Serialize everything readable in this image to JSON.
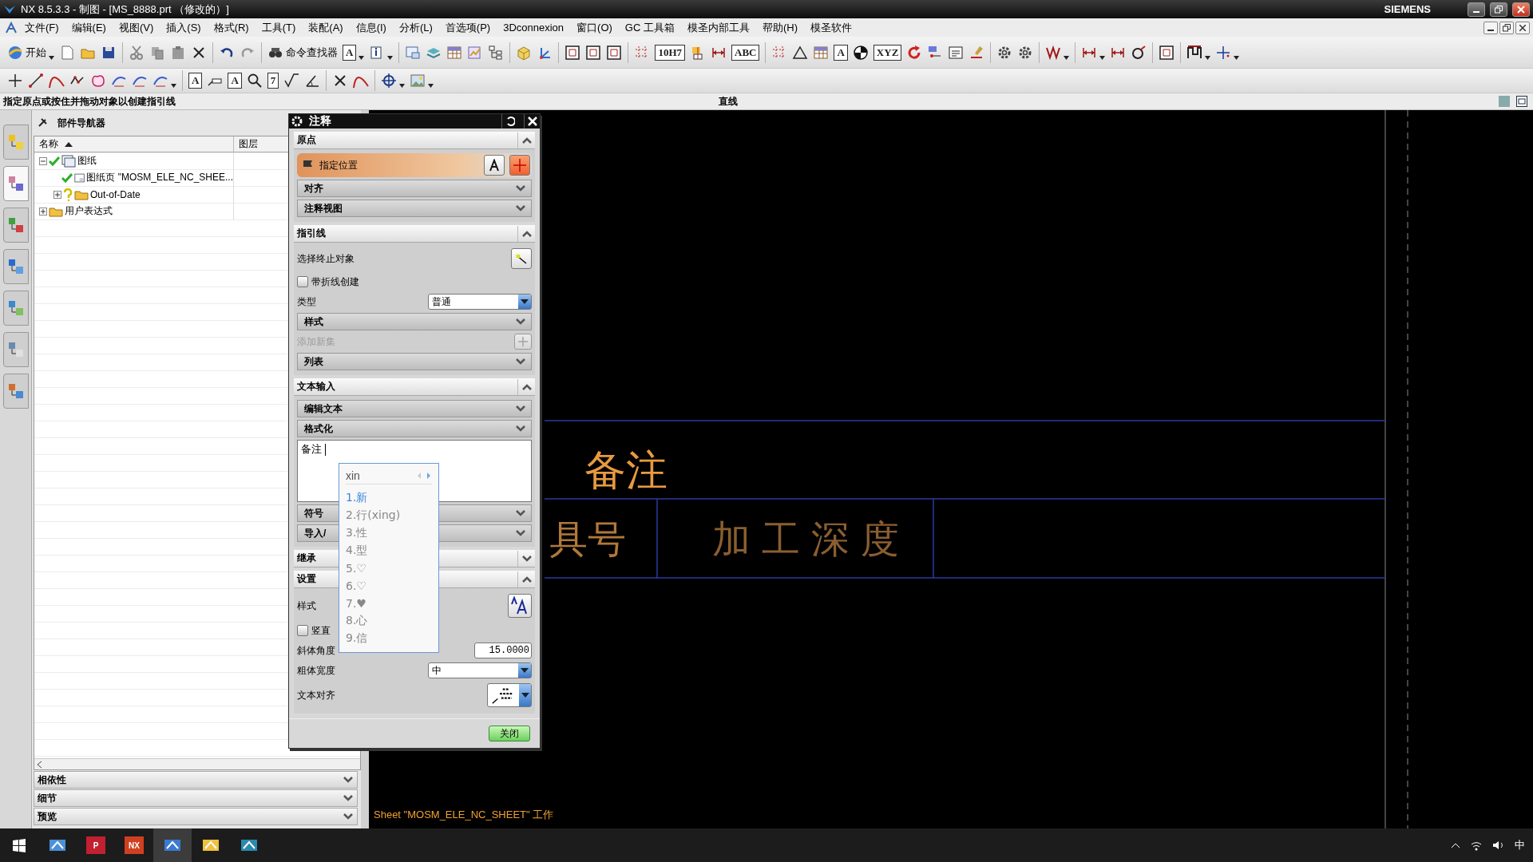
{
  "window": {
    "title": "NX 8.5.3.3 - 制图 - [MS_8888.prt  （修改的）]",
    "brand": "SIEMENS"
  },
  "menu": [
    "文件(F)",
    "编辑(E)",
    "视图(V)",
    "插入(S)",
    "格式(R)",
    "工具(T)",
    "装配(A)",
    "信息(I)",
    "分析(L)",
    "首选项(P)",
    "3Dconnexion",
    "窗口(O)",
    "GC 工具箱",
    "模圣内部工具",
    "帮助(H)",
    "模圣软件"
  ],
  "toolbar_1": [
    {
      "kind": "text",
      "text": "开始",
      "menu": true
    },
    {
      "kind": "icon"
    },
    {
      "kind": "icon"
    },
    {
      "kind": "icon"
    },
    {
      "kind": "sep"
    },
    {
      "kind": "icon"
    },
    {
      "kind": "icon"
    },
    {
      "kind": "icon"
    },
    {
      "kind": "icon"
    },
    {
      "kind": "sep"
    },
    {
      "kind": "icon"
    },
    {
      "kind": "icon"
    },
    {
      "kind": "sep"
    },
    {
      "kind": "text",
      "text": "命令查找器"
    },
    {
      "kind": "glyph",
      "text": "A",
      "menu": true
    },
    {
      "kind": "icon",
      "menu": true
    },
    {
      "kind": "sep"
    },
    {
      "kind": "icon"
    },
    {
      "kind": "icon"
    },
    {
      "kind": "icon"
    },
    {
      "kind": "icon"
    },
    {
      "kind": "icon"
    },
    {
      "kind": "sep"
    },
    {
      "kind": "icon"
    },
    {
      "kind": "icon"
    },
    {
      "kind": "sep"
    },
    {
      "kind": "icon"
    },
    {
      "kind": "icon"
    },
    {
      "kind": "icon"
    },
    {
      "kind": "sep"
    },
    {
      "kind": "icon"
    },
    {
      "kind": "glyph",
      "text": "10H7"
    },
    {
      "kind": "icon"
    },
    {
      "kind": "icon"
    },
    {
      "kind": "glyph",
      "text": "ABC"
    },
    {
      "kind": "sep"
    },
    {
      "kind": "icon"
    },
    {
      "kind": "icon"
    },
    {
      "kind": "icon"
    },
    {
      "kind": "glyph",
      "text": "A"
    },
    {
      "kind": "icon"
    },
    {
      "kind": "glyph",
      "text": "XYZ"
    },
    {
      "kind": "icon"
    },
    {
      "kind": "icon"
    },
    {
      "kind": "icon"
    },
    {
      "kind": "icon"
    },
    {
      "kind": "sep"
    },
    {
      "kind": "icon"
    },
    {
      "kind": "icon"
    },
    {
      "kind": "sep"
    },
    {
      "kind": "icon",
      "menu": true
    },
    {
      "kind": "sep"
    },
    {
      "kind": "icon",
      "menu": true
    },
    {
      "kind": "icon"
    },
    {
      "kind": "icon"
    },
    {
      "kind": "sep"
    },
    {
      "kind": "icon"
    },
    {
      "kind": "sep"
    },
    {
      "kind": "icon",
      "menu": true
    },
    {
      "kind": "icon",
      "menu": true
    }
  ],
  "toolbar_2": [
    {
      "kind": "icon"
    },
    {
      "kind": "icon"
    },
    {
      "kind": "icon"
    },
    {
      "kind": "icon"
    },
    {
      "kind": "icon"
    },
    {
      "kind": "icon"
    },
    {
      "kind": "icon"
    },
    {
      "kind": "icon",
      "menu": true
    },
    {
      "kind": "sep"
    },
    {
      "kind": "glyph",
      "text": "A"
    },
    {
      "kind": "icon"
    },
    {
      "kind": "glyph",
      "text": "A"
    },
    {
      "kind": "icon"
    },
    {
      "kind": "glyph",
      "text": "7"
    },
    {
      "kind": "icon"
    },
    {
      "kind": "icon"
    },
    {
      "kind": "sep"
    },
    {
      "kind": "icon"
    },
    {
      "kind": "icon"
    },
    {
      "kind": "sep"
    },
    {
      "kind": "icon",
      "menu": true
    },
    {
      "kind": "icon",
      "menu": true
    }
  ],
  "status_line": {
    "prompt": "指定原点或按住并拖动对象以创建指引线",
    "mode": "直线"
  },
  "resource_tabs": [
    {
      "selected": false
    },
    {
      "selected": true
    },
    {
      "selected": false
    },
    {
      "selected": false
    },
    {
      "selected": false
    },
    {
      "selected": false
    },
    {
      "selected": false
    }
  ],
  "navigator": {
    "title": "部件导航器",
    "columns": [
      {
        "label": "名称",
        "sorted": true
      },
      {
        "label": "图层",
        "sorted": false
      }
    ],
    "tree": [
      {
        "label": "图纸",
        "kind": "drawing",
        "up_to_date": true,
        "expanded": true,
        "children": [
          {
            "label": "图纸页 \"MOSM_ELE_NC_SHEE...",
            "kind": "sheet",
            "up_to_date": true
          },
          {
            "label": "Out-of-Date",
            "kind": "folder",
            "up_to_date": false,
            "questioned": true,
            "expanded": false
          }
        ]
      },
      {
        "label": "用户表达式",
        "kind": "folder",
        "expanded": false
      }
    ],
    "panels": [
      {
        "label": "相依性",
        "expanded": false
      },
      {
        "label": "细节",
        "expanded": false
      },
      {
        "label": "预览",
        "expanded": false
      }
    ]
  },
  "dialog": {
    "title": "注释",
    "sections": [
      {
        "title": "原点",
        "expanded": true,
        "rows": [
          {
            "kind": "select",
            "label": "指定位置",
            "active": true
          },
          {
            "kind": "subgroup",
            "label": "对齐"
          },
          {
            "kind": "subgroup",
            "label": "注释视图"
          }
        ]
      },
      {
        "title": "指引线",
        "expanded": true,
        "rows": [
          {
            "kind": "pick",
            "label": "选择终止对象"
          },
          {
            "kind": "checkbox",
            "label": "带折线创建",
            "checked": false
          },
          {
            "kind": "dropdown",
            "label": "类型",
            "value": "普通"
          },
          {
            "kind": "subgroup",
            "label": "样式"
          },
          {
            "kind": "action",
            "label": "添加新集",
            "disabled": true
          },
          {
            "kind": "subgroup",
            "label": "列表"
          }
        ]
      },
      {
        "title": "文本输入",
        "expanded": true,
        "rows": [
          {
            "kind": "subgroup",
            "label": "编辑文本"
          },
          {
            "kind": "subgroup",
            "label": "格式化"
          },
          {
            "kind": "textarea",
            "value": "备注 "
          },
          {
            "kind": "subgroup",
            "label": "符号"
          },
          {
            "kind": "subgroup",
            "label": "导入/"
          }
        ]
      },
      {
        "title": "继承",
        "expanded": false
      },
      {
        "title": "设置",
        "expanded": true,
        "rows": [
          {
            "kind": "style",
            "label": "样式"
          },
          {
            "kind": "checkbox",
            "label": "竖直",
            "checked": false
          },
          {
            "kind": "field",
            "label": "斜体角度",
            "value": "15.0000"
          },
          {
            "kind": "dropdown",
            "label": "粗体宽度",
            "value": "中"
          },
          {
            "kind": "align",
            "label": "文本对齐"
          }
        ]
      }
    ],
    "close": "关闭"
  },
  "ime": {
    "input": "xin",
    "candidates": [
      {
        "text": "1.新",
        "selected": true
      },
      {
        "text": "2.行(xing)",
        "selected": false
      },
      {
        "text": "3.性",
        "selected": false
      },
      {
        "text": "4.型",
        "selected": false
      },
      {
        "text": "5.♡",
        "selected": false
      },
      {
        "text": "6.♡",
        "selected": false
      },
      {
        "text": "7.♥",
        "selected": false
      },
      {
        "text": "8.心",
        "selected": false
      },
      {
        "text": "9.信",
        "selected": false
      }
    ]
  },
  "canvas": {
    "note_title": "备注",
    "cells": [
      "具号",
      "加工深度"
    ],
    "sheet_status": "Sheet \"MOSM_ELE_NC_SHEET\" 工作"
  },
  "taskbar": {
    "apps": [
      {
        "selected": false
      },
      {
        "selected": false,
        "label": "P"
      },
      {
        "selected": false,
        "label": "NX"
      },
      {
        "selected": true
      },
      {
        "selected": false
      },
      {
        "selected": false
      }
    ],
    "ime_mode": "中"
  }
}
